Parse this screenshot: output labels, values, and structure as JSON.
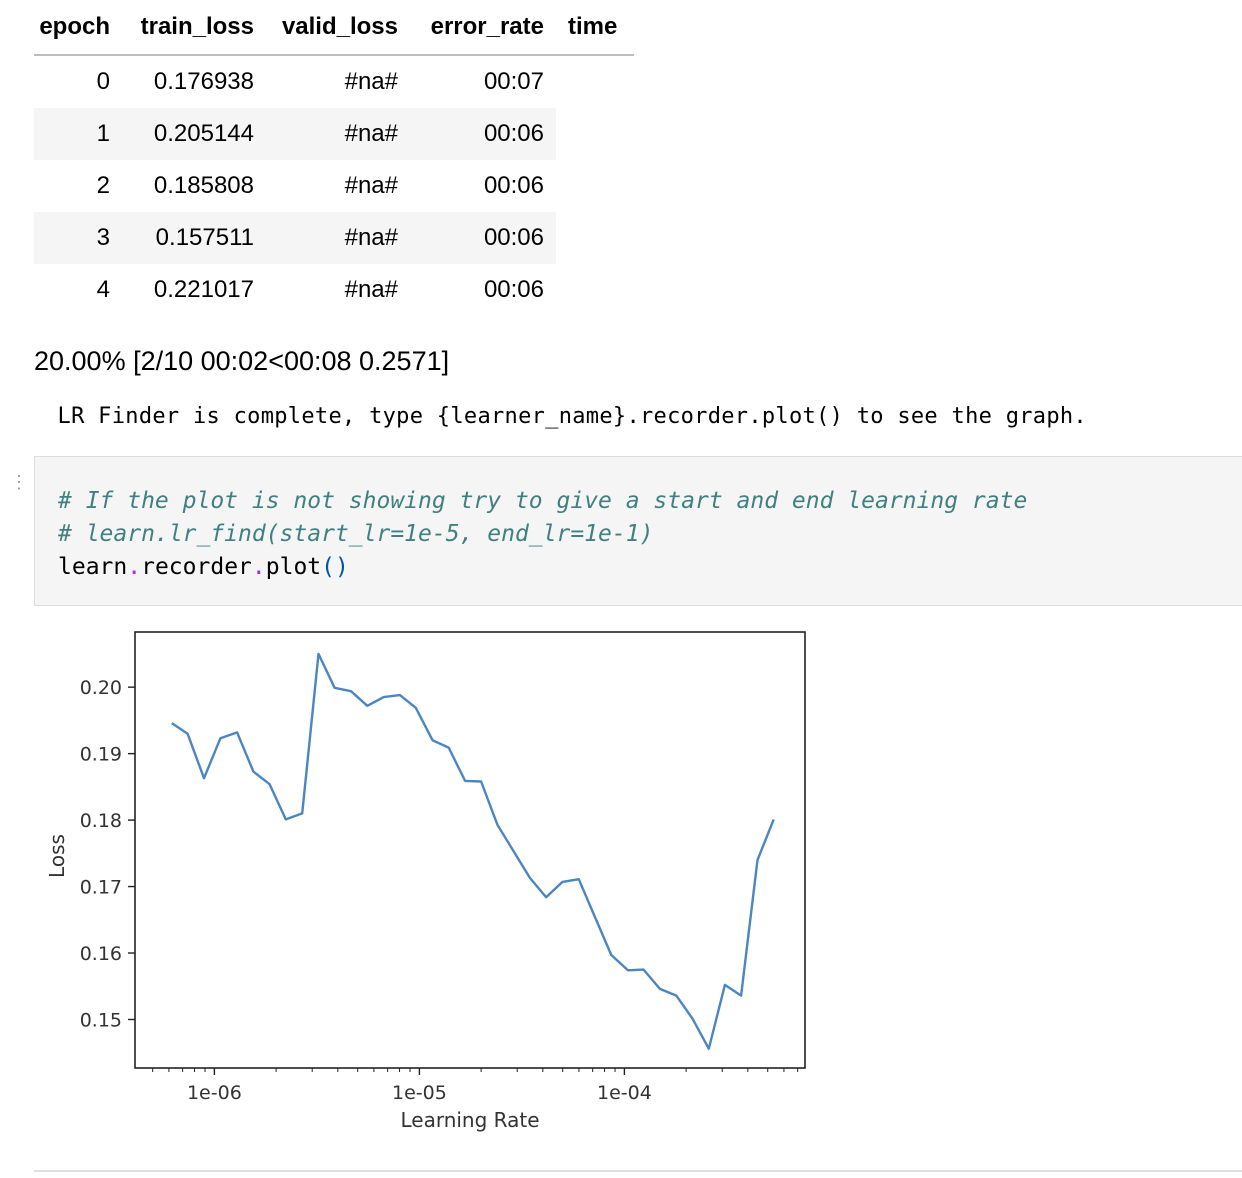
{
  "results_table": {
    "headers": [
      "epoch",
      "train_loss",
      "valid_loss",
      "error_rate",
      "time"
    ],
    "rows": [
      {
        "epoch": "0",
        "train_loss": "0.176938",
        "valid_loss": "#na#",
        "error_rate": "00:07",
        "time": ""
      },
      {
        "epoch": "1",
        "train_loss": "0.205144",
        "valid_loss": "#na#",
        "error_rate": "00:06",
        "time": ""
      },
      {
        "epoch": "2",
        "train_loss": "0.185808",
        "valid_loss": "#na#",
        "error_rate": "00:06",
        "time": ""
      },
      {
        "epoch": "3",
        "train_loss": "0.157511",
        "valid_loss": "#na#",
        "error_rate": "00:06",
        "time": ""
      },
      {
        "epoch": "4",
        "train_loss": "0.221017",
        "valid_loss": "#na#",
        "error_rate": "00:06",
        "time": ""
      }
    ]
  },
  "progress": "20.00% [2/10 00:02<00:08 0.2571]",
  "stdout": " LR Finder is complete, type {learner_name}.recorder.plot() to see the graph.",
  "code_cell": {
    "line1": "# If the plot is not showing try to give a start and end learning rate",
    "line2": "# learn.lr_find(start_lr=1e-5, end_lr=1e-1)",
    "line3_obj": "learn",
    "line3_dot1": ".",
    "line3_attr": "recorder",
    "line3_dot2": ".",
    "line3_method": "plot",
    "line3_parens": "()"
  },
  "chart_data": {
    "type": "line",
    "xlabel": "Learning Rate",
    "ylabel": "Loss",
    "xscale": "log",
    "xlim": [
      4.1e-07,
      0.00076
    ],
    "ylim": [
      0.1427,
      0.2083
    ],
    "xtick_labels": [
      "1e-06",
      "1e-05",
      "1e-04"
    ],
    "ytick_labels": [
      "0.15",
      "0.16",
      "0.17",
      "0.18",
      "0.19",
      "0.20"
    ],
    "grid": false,
    "line_color": "#4c86c0",
    "series": [
      {
        "x": [
          6.2e-07,
          7.4e-07,
          8.9e-07,
          1.07e-06,
          1.29e-06,
          1.55e-06,
          1.86e-06,
          2.23e-06,
          2.68e-06,
          3.22e-06,
          3.86e-06,
          4.64e-06,
          5.57e-06,
          6.69e-06,
          8.03e-06,
          9.6e-06,
          1.16e-05,
          1.39e-05,
          1.67e-05,
          2e-05,
          2.4e-05,
          2.88e-05,
          3.46e-05,
          4.15e-05,
          4.99e-05,
          5.99e-05,
          7.19e-05,
          8.63e-05,
          0.000104,
          0.000124,
          0.000149,
          0.000179,
          0.000215,
          0.000258,
          0.000309,
          0.000371,
          0.000446,
          0.000535
        ],
        "y": [
          0.1946,
          0.193,
          0.1863,
          0.1923,
          0.1932,
          0.1873,
          0.1854,
          0.1801,
          0.181,
          0.205,
          0.1999,
          0.1994,
          0.1972,
          0.1985,
          0.1988,
          0.1969,
          0.192,
          0.1909,
          0.1859,
          0.1858,
          0.1793,
          0.1753,
          0.1713,
          0.1684,
          0.1707,
          0.1711,
          0.1654,
          0.1597,
          0.1574,
          0.1575,
          0.1546,
          0.1536,
          0.1501,
          0.1456,
          0.1552,
          0.1536,
          0.174,
          0.1801
        ]
      }
    ]
  }
}
